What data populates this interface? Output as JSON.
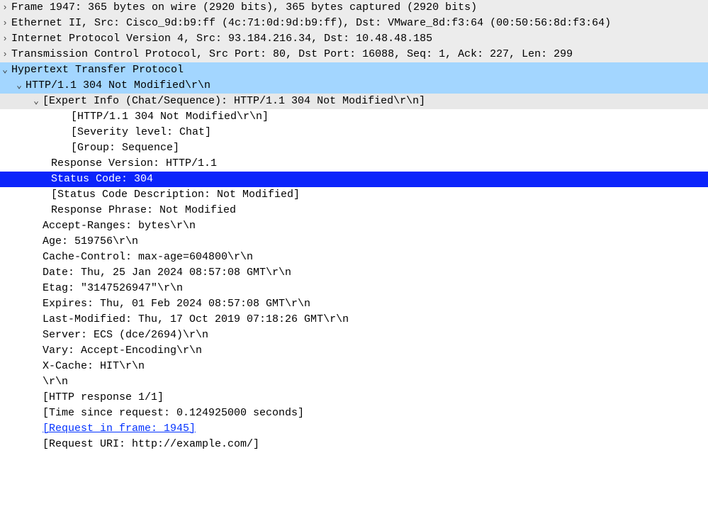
{
  "frame_line": "Frame 1947: 365 bytes on wire (2920 bits), 365 bytes captured (2920 bits)",
  "eth_line": "Ethernet II, Src: Cisco_9d:b9:ff (4c:71:0d:9d:b9:ff), Dst: VMware_8d:f3:64 (00:50:56:8d:f3:64)",
  "ip_line": "Internet Protocol Version 4, Src: 93.184.216.34, Dst: 10.48.48.185",
  "tcp_line": "Transmission Control Protocol, Src Port: 80, Dst Port: 16088, Seq: 1, Ack: 227, Len: 299",
  "http_header": "Hypertext Transfer Protocol",
  "status_line": "HTTP/1.1 304 Not Modified\\r\\n",
  "expert_info": "[Expert Info (Chat/Sequence): HTTP/1.1 304 Not Modified\\r\\n]",
  "expert_detail": "[HTTP/1.1 304 Not Modified\\r\\n]",
  "severity": "[Severity level: Chat]",
  "group": "[Group: Sequence]",
  "resp_version": "Response Version: HTTP/1.1",
  "status_code": "Status Code: 304",
  "status_desc": "[Status Code Description: Not Modified]",
  "resp_phrase": "Response Phrase: Not Modified",
  "h_accept_ranges": "Accept-Ranges: bytes\\r\\n",
  "h_age": "Age: 519756\\r\\n",
  "h_cache_control": "Cache-Control: max-age=604800\\r\\n",
  "h_date": "Date: Thu, 25 Jan 2024 08:57:08 GMT\\r\\n",
  "h_etag": "Etag: \"3147526947\"\\r\\n",
  "h_expires": "Expires: Thu, 01 Feb 2024 08:57:08 GMT\\r\\n",
  "h_last_modified": "Last-Modified: Thu, 17 Oct 2019 07:18:26 GMT\\r\\n",
  "h_server": "Server: ECS (dce/2694)\\r\\n",
  "h_vary": "Vary: Accept-Encoding\\r\\n",
  "h_xcache": "X-Cache: HIT\\r\\n",
  "h_crlf": "\\r\\n",
  "http_response_n": "[HTTP response 1/1]",
  "time_since": "[Time since request: 0.124925000 seconds]",
  "request_in_frame": "[Request in frame: 1945]",
  "request_uri": "[Request URI: http://example.com/]",
  "chev_right": "›",
  "chev_down": "⌄"
}
